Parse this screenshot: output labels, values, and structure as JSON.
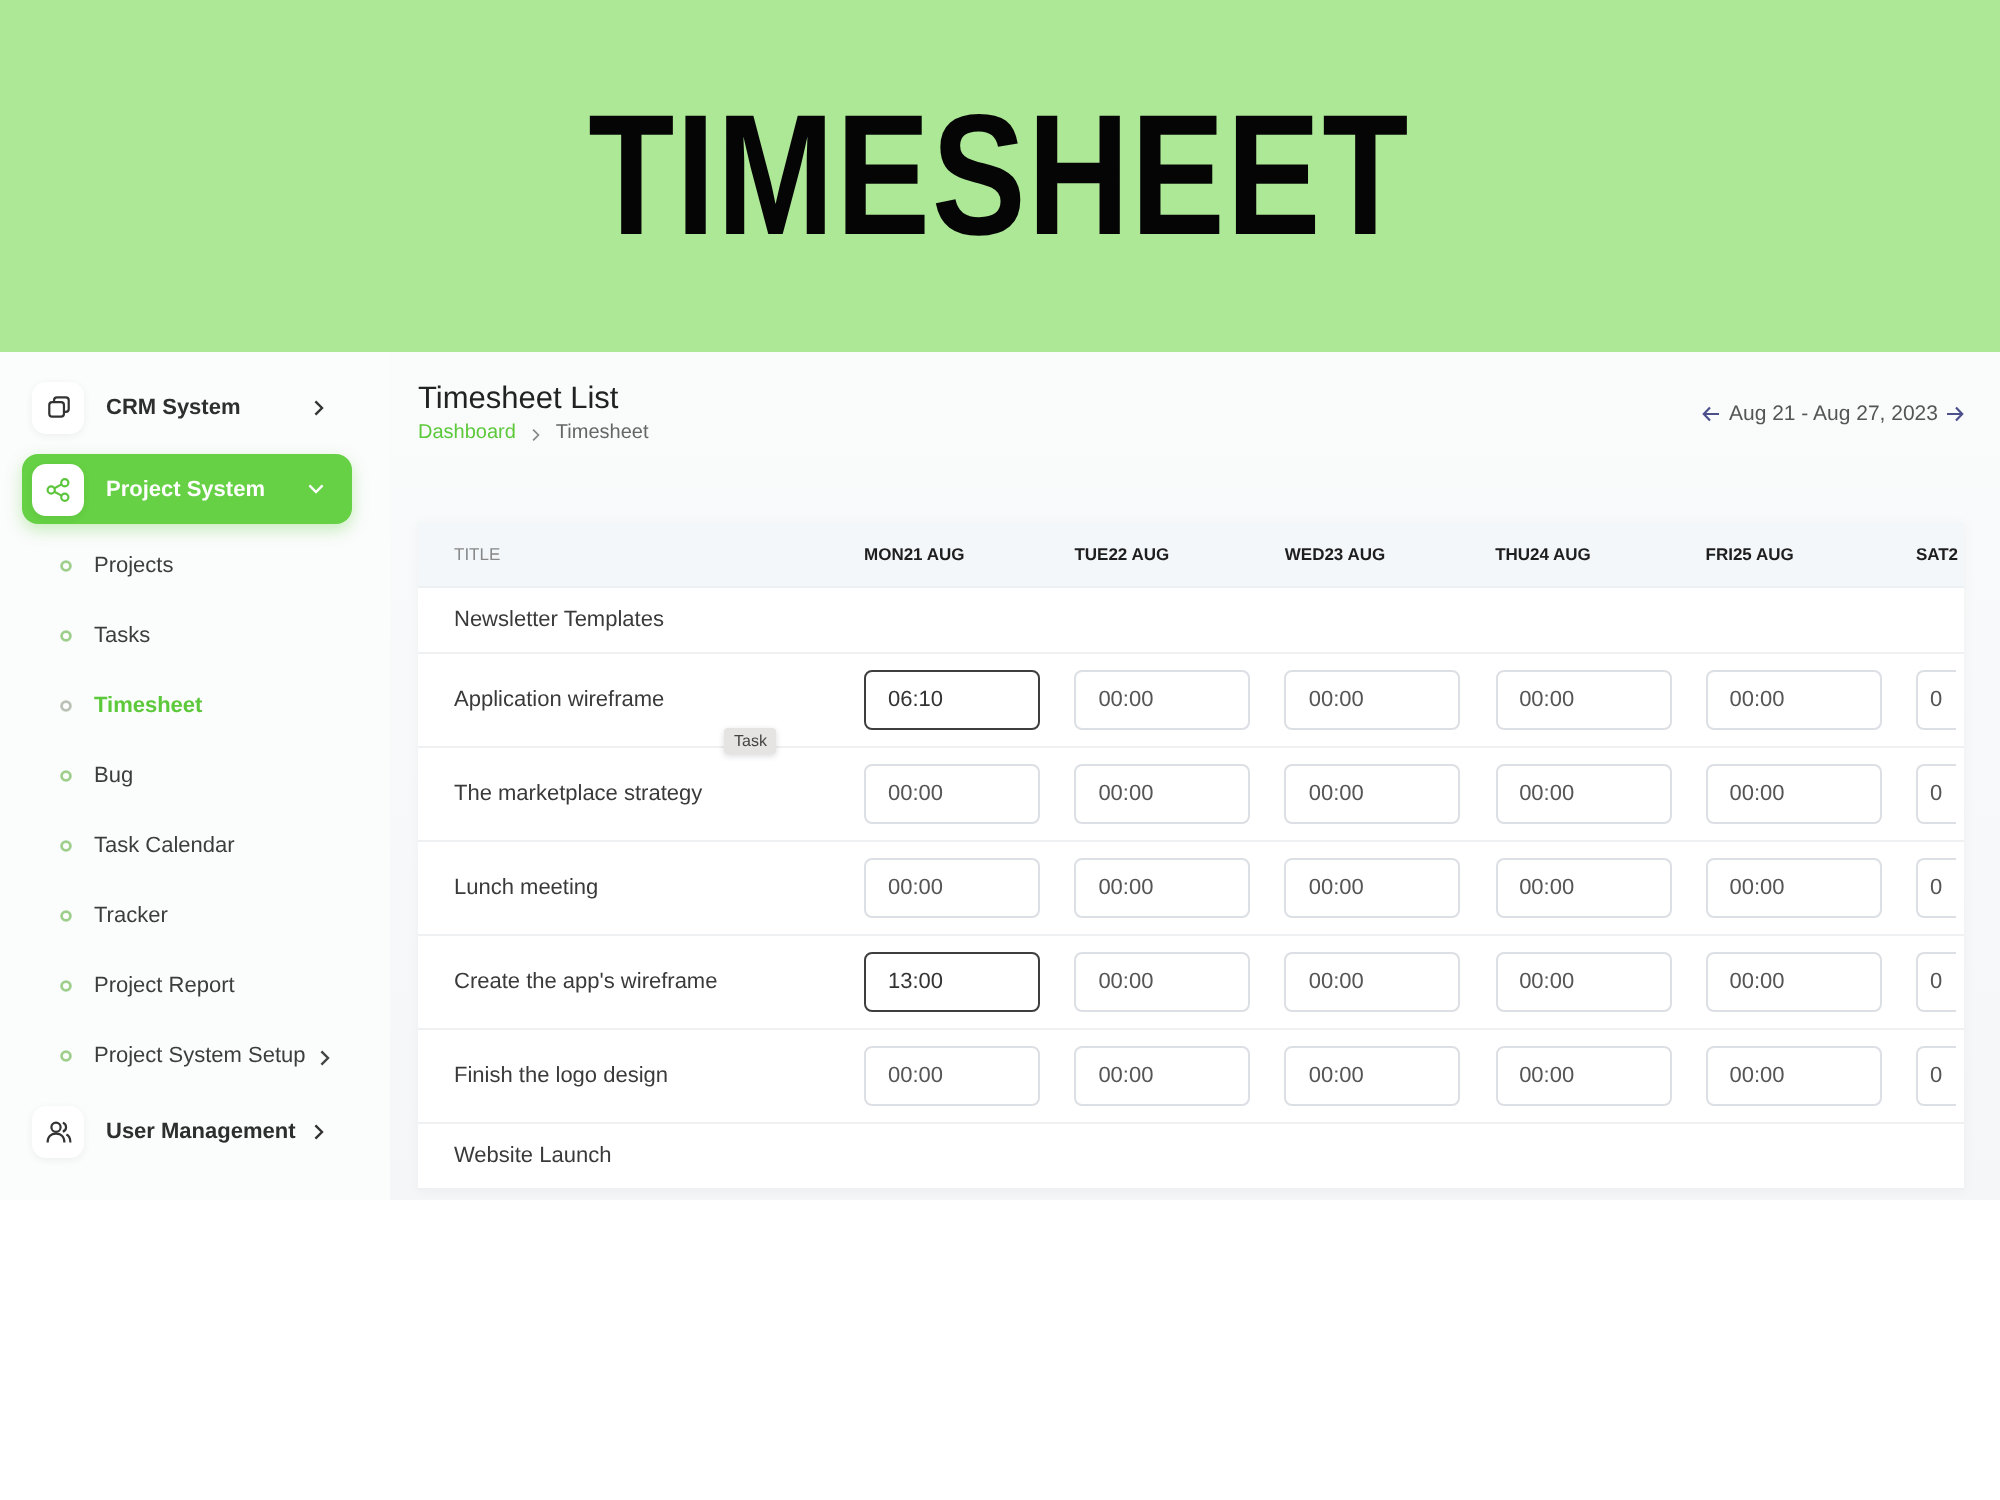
{
  "banner": {
    "title": "TIMESHEET"
  },
  "sidebar": {
    "items": [
      {
        "label": "CRM System",
        "selected": false,
        "expanded": false
      },
      {
        "label": "Project System",
        "selected": true,
        "expanded": true,
        "children": [
          {
            "label": "Projects",
            "kind": "link",
            "selected": false
          },
          {
            "label": "Tasks",
            "kind": "link",
            "selected": false
          },
          {
            "label": "Timesheet",
            "kind": "link",
            "selected": true
          },
          {
            "label": "Bug",
            "kind": "link",
            "selected": false
          },
          {
            "label": "Task Calendar",
            "kind": "link",
            "selected": false
          },
          {
            "label": "Tracker",
            "kind": "link",
            "selected": false
          },
          {
            "label": "Project Report",
            "kind": "link",
            "selected": false
          },
          {
            "label": "Project System Setup",
            "kind": "submenu",
            "selected": false
          }
        ]
      },
      {
        "label": "User Management",
        "selected": false,
        "expanded": false
      }
    ]
  },
  "header": {
    "title": "Timesheet List",
    "breadcrumb": [
      {
        "label": "Dashboard",
        "current": false
      },
      {
        "label": "Timesheet",
        "current": true
      }
    ],
    "date_range": "Aug 21 - Aug 27, 2023"
  },
  "table": {
    "columns": [
      "TITLE",
      "MON21 AUG",
      "TUE22 AUG",
      "WED23 AUG",
      "THU24 AUG",
      "FRI25 AUG",
      "SAT2"
    ],
    "rows": [
      {
        "kind": "group",
        "title": "Newsletter Templates"
      },
      {
        "kind": "task",
        "title": "Application wireframe",
        "entries": [
          {
            "value": "06:10",
            "edited": true
          },
          {
            "value": "00:00",
            "edited": false
          },
          {
            "value": "00:00",
            "edited": false
          },
          {
            "value": "00:00",
            "edited": false
          },
          {
            "value": "00:00",
            "edited": false
          },
          {
            "value": "0",
            "edited": false
          }
        ]
      },
      {
        "kind": "task",
        "title": "The marketplace strategy",
        "entries": [
          {
            "value": "00:00",
            "edited": false
          },
          {
            "value": "00:00",
            "edited": false
          },
          {
            "value": "00:00",
            "edited": false
          },
          {
            "value": "00:00",
            "edited": false
          },
          {
            "value": "00:00",
            "edited": false
          },
          {
            "value": "0",
            "edited": false
          }
        ]
      },
      {
        "kind": "task",
        "title": "Lunch meeting",
        "entries": [
          {
            "value": "00:00",
            "edited": false
          },
          {
            "value": "00:00",
            "edited": false
          },
          {
            "value": "00:00",
            "edited": false
          },
          {
            "value": "00:00",
            "edited": false
          },
          {
            "value": "00:00",
            "edited": false
          },
          {
            "value": "0",
            "edited": false
          }
        ]
      },
      {
        "kind": "task",
        "title": "Create the app's wireframe",
        "entries": [
          {
            "value": "13:00",
            "edited": true
          },
          {
            "value": "00:00",
            "edited": false
          },
          {
            "value": "00:00",
            "edited": false
          },
          {
            "value": "00:00",
            "edited": false
          },
          {
            "value": "00:00",
            "edited": false
          },
          {
            "value": "0",
            "edited": false
          }
        ]
      },
      {
        "kind": "task",
        "title": "Finish the logo design",
        "entries": [
          {
            "value": "00:00",
            "edited": false
          },
          {
            "value": "00:00",
            "edited": false
          },
          {
            "value": "00:00",
            "edited": false
          },
          {
            "value": "00:00",
            "edited": false
          },
          {
            "value": "00:00",
            "edited": false
          },
          {
            "value": "0",
            "edited": false
          }
        ]
      },
      {
        "kind": "group",
        "title": "Website Launch"
      }
    ]
  },
  "tooltip": {
    "text": "Task"
  }
}
